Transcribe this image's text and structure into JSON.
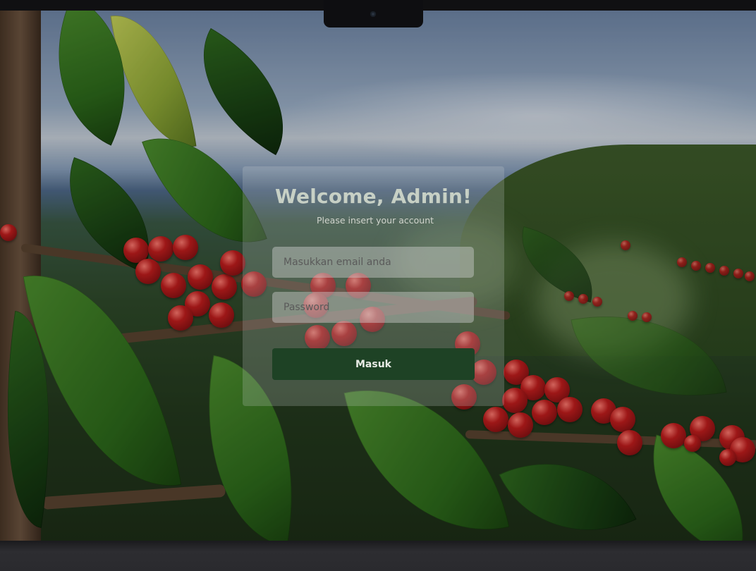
{
  "login": {
    "title": "Welcome, Admin!",
    "subtitle": "Please insert your account",
    "email_placeholder": "Masukkan email anda",
    "password_placeholder": "Password",
    "submit_label": "Masuk"
  },
  "colors": {
    "button_bg": "#1e4225",
    "card_bg": "rgba(210,215,215,0.22)",
    "title": "#c7d0c5"
  },
  "icons": {
    "camera": "camera-dot"
  }
}
